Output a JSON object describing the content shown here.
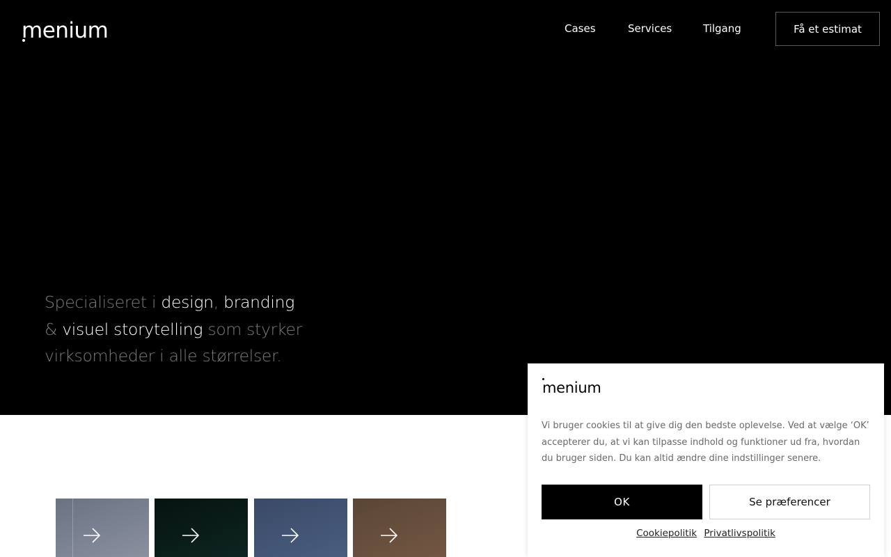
{
  "brand": {
    "logo_text": "menium"
  },
  "nav": {
    "items": [
      {
        "label": "Cases"
      },
      {
        "label": "Services"
      },
      {
        "label": "Tilgang"
      }
    ],
    "cta_label": "Få et estimat"
  },
  "hero": {
    "tagline_parts": [
      "Specialiseret i ",
      "design",
      ", ",
      "branding",
      " & ",
      "visuel storytelling",
      " som styrker virksomheder i alle størrelser."
    ]
  },
  "thumbnails": [
    {
      "icon": "arrow-right-icon",
      "colors": [
        "#6b7282",
        "#8a909e"
      ]
    },
    {
      "icon": "arrow-right-icon",
      "colors": [
        "#061310",
        "#0d2420"
      ]
    },
    {
      "icon": "arrow-right-icon",
      "colors": [
        "#3a4a66",
        "#4a5d80"
      ]
    },
    {
      "icon": "arrow-right-icon",
      "colors": [
        "#5a4636",
        "#735643"
      ]
    }
  ],
  "cookie": {
    "logo_text": "menium",
    "message": "Vi bruger cookies til at give dig den bedste oplevelse. Ved at vælge ‘OK’ accepterer du, at vi kan tilpasse indhold og funktioner ud fra, hvordan du bruger siden. Du kan altid ændre dine indstillinger senere.",
    "ok_label": "OK",
    "preferences_label": "Se præferencer",
    "links": [
      {
        "label": "Cookiepolitik"
      },
      {
        "label": "Privatlivspolitik"
      }
    ]
  },
  "colors": {
    "hero_bg": "#000000",
    "text_muted": "#7c7c7c",
    "text_highlight": "#ffffff"
  }
}
